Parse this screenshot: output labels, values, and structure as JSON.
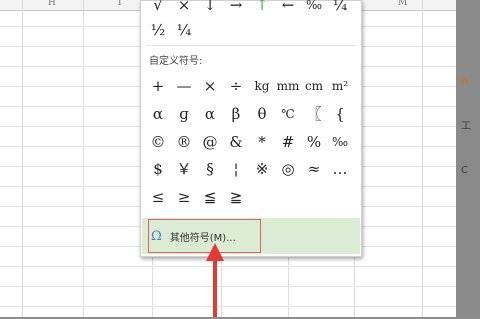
{
  "column_headers": [
    "H",
    "I",
    "M"
  ],
  "right_panel": {
    "text_1": "A",
    "text_2": "工",
    "text_3": "C"
  },
  "symbols_top": [
    [
      "√",
      "×",
      "↓",
      "→",
      "↑",
      "←",
      "‰",
      "¼"
    ],
    [
      "½",
      "¼"
    ]
  ],
  "custom_section": {
    "title": "自定义符号:",
    "rows": [
      [
        "+",
        "—",
        "×",
        "÷",
        "kg",
        "mm",
        "cm",
        "m²"
      ],
      [
        "α",
        "ɡ",
        "α",
        "β",
        "θ",
        "℃",
        "〖",
        "{"
      ],
      [
        "©",
        "®",
        "@",
        "&",
        "*",
        "#",
        "%",
        "‰"
      ],
      [
        "$",
        "￥",
        "§",
        "¦",
        "※",
        "◎",
        "≈",
        "…"
      ],
      [
        "≤",
        "≥",
        "≦",
        "≧"
      ]
    ]
  },
  "more_symbols": {
    "icon": "omega-icon",
    "label": "其他符号(M)..."
  },
  "colors": {
    "highlight": "#dcebd3",
    "border_red": "#e06060",
    "arrow_red": "#e53935"
  }
}
